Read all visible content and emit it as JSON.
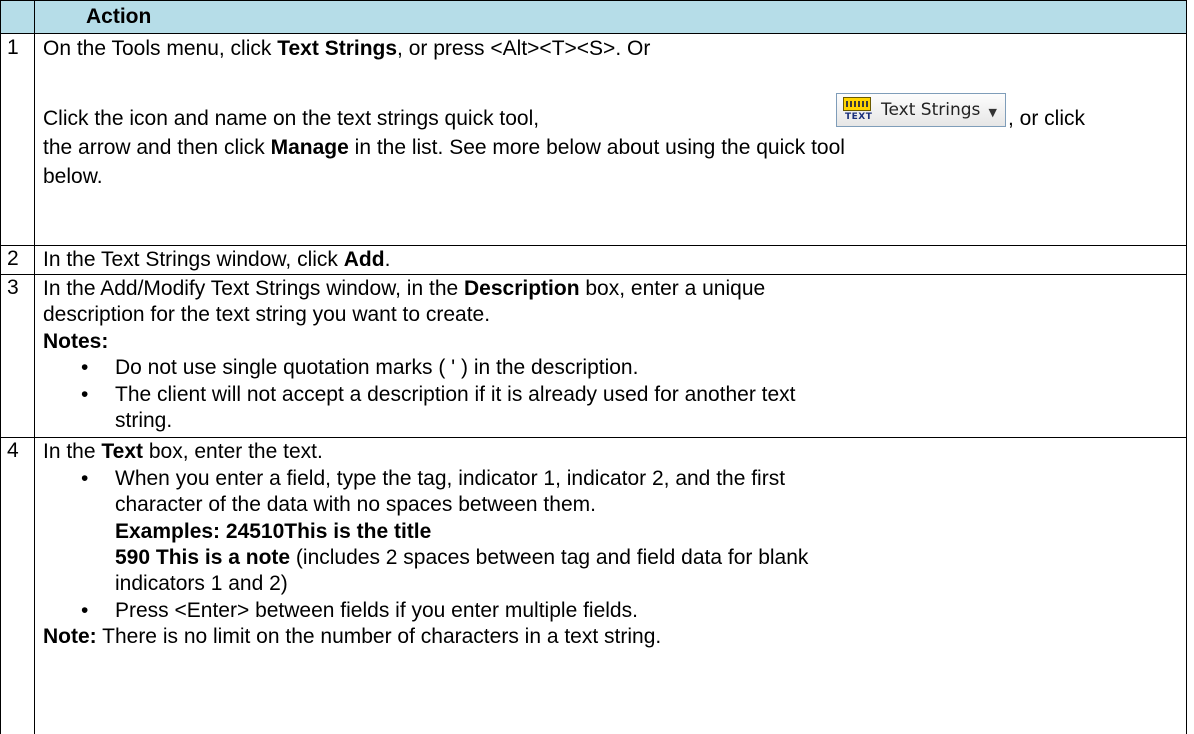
{
  "header": {
    "action": "Action"
  },
  "rows": [
    {
      "num": "1",
      "line1_pre": "On the Tools menu, click ",
      "line1_bold": "Text Strings",
      "line1_post": ", or press <Alt><T><S>. Or",
      "line2_pre": "Click the icon and name on the text strings quick tool,",
      "line2_post": ", or click",
      "line3_pre": "the arrow and then click ",
      "line3_bold": "Manage",
      "line3_post": " in the list. See more below about using the quick tool",
      "line4": "below."
    },
    {
      "num": "2",
      "pre": "In the Text Strings window, click ",
      "bold": "Add",
      "post": "."
    },
    {
      "num": "3",
      "line1_pre": "In the Add/Modify Text Strings window, in the ",
      "line1_bold": "Description",
      "line1_post": " box, enter a unique",
      "line2": "description for the text string you want to create.",
      "notes_label": "Notes:",
      "bullets": [
        "Do not use single quotation marks ( ' ) in the description.",
        "The client will not accept a description if it is already used for another text",
        "string."
      ]
    },
    {
      "num": "4",
      "line1_pre": "In the ",
      "line1_bold": "Text",
      "line1_post": "  box, enter the text.",
      "b1_line1": "When you enter a field, type the tag, indicator 1, indicator 2, and the first",
      "b1_line2": "character of the data with no spaces between them.",
      "b1_example1": "Examples: 24510This is the title",
      "b1_example2_bold": "590 This is a note",
      "b1_example2_post": " (includes 2 spaces between tag and field data for blank",
      "b1_line5": "indicators 1 and 2)",
      "b2": "Press <Enter> between fields if you enter multiple fields.",
      "note_bold": "Note:",
      "note_text": "  There is no limit on the number of characters in a text string."
    }
  ],
  "quick_tool": {
    "icon_tag": "TEXT",
    "label": "Text Strings",
    "icon": "keyboard-icon",
    "arrow_icon": "dropdown-arrow-icon"
  },
  "colors": {
    "header_bg": "#b6dde8",
    "border": "#000000"
  }
}
